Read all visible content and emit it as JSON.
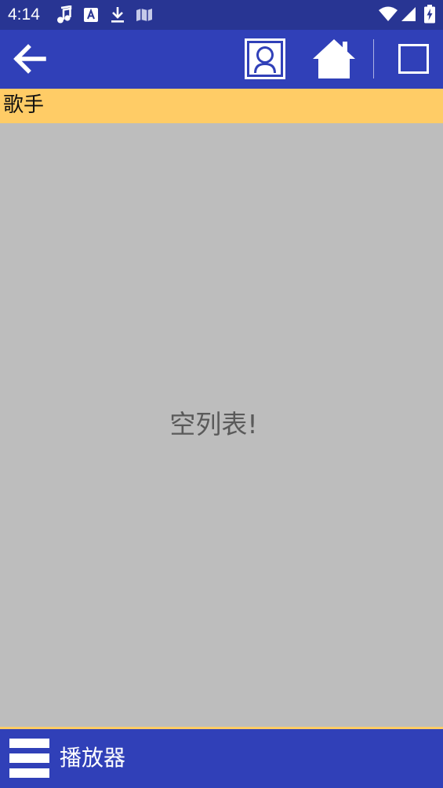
{
  "status_bar": {
    "time": "4:14",
    "icons": [
      "music-note-icon",
      "font-a-icon",
      "download-icon",
      "map-icon",
      "wifi-icon",
      "signal-icon",
      "battery-charging-icon"
    ]
  },
  "app_bar": {
    "back_icon": "arrow-left-icon",
    "actions": [
      "contact-portrait-icon",
      "home-icon",
      "square-icon"
    ]
  },
  "section": {
    "title": "歌手"
  },
  "main": {
    "empty_message": "空列表!"
  },
  "bottom_bar": {
    "menu_icon": "menu-icon",
    "player_label": "播放器"
  },
  "colors": {
    "status_bar": "#283593",
    "app_bar": "#3040b8",
    "accent": "#ffcc66",
    "content_bg": "#bdbdbd",
    "empty_text": "#5a5a5a"
  }
}
